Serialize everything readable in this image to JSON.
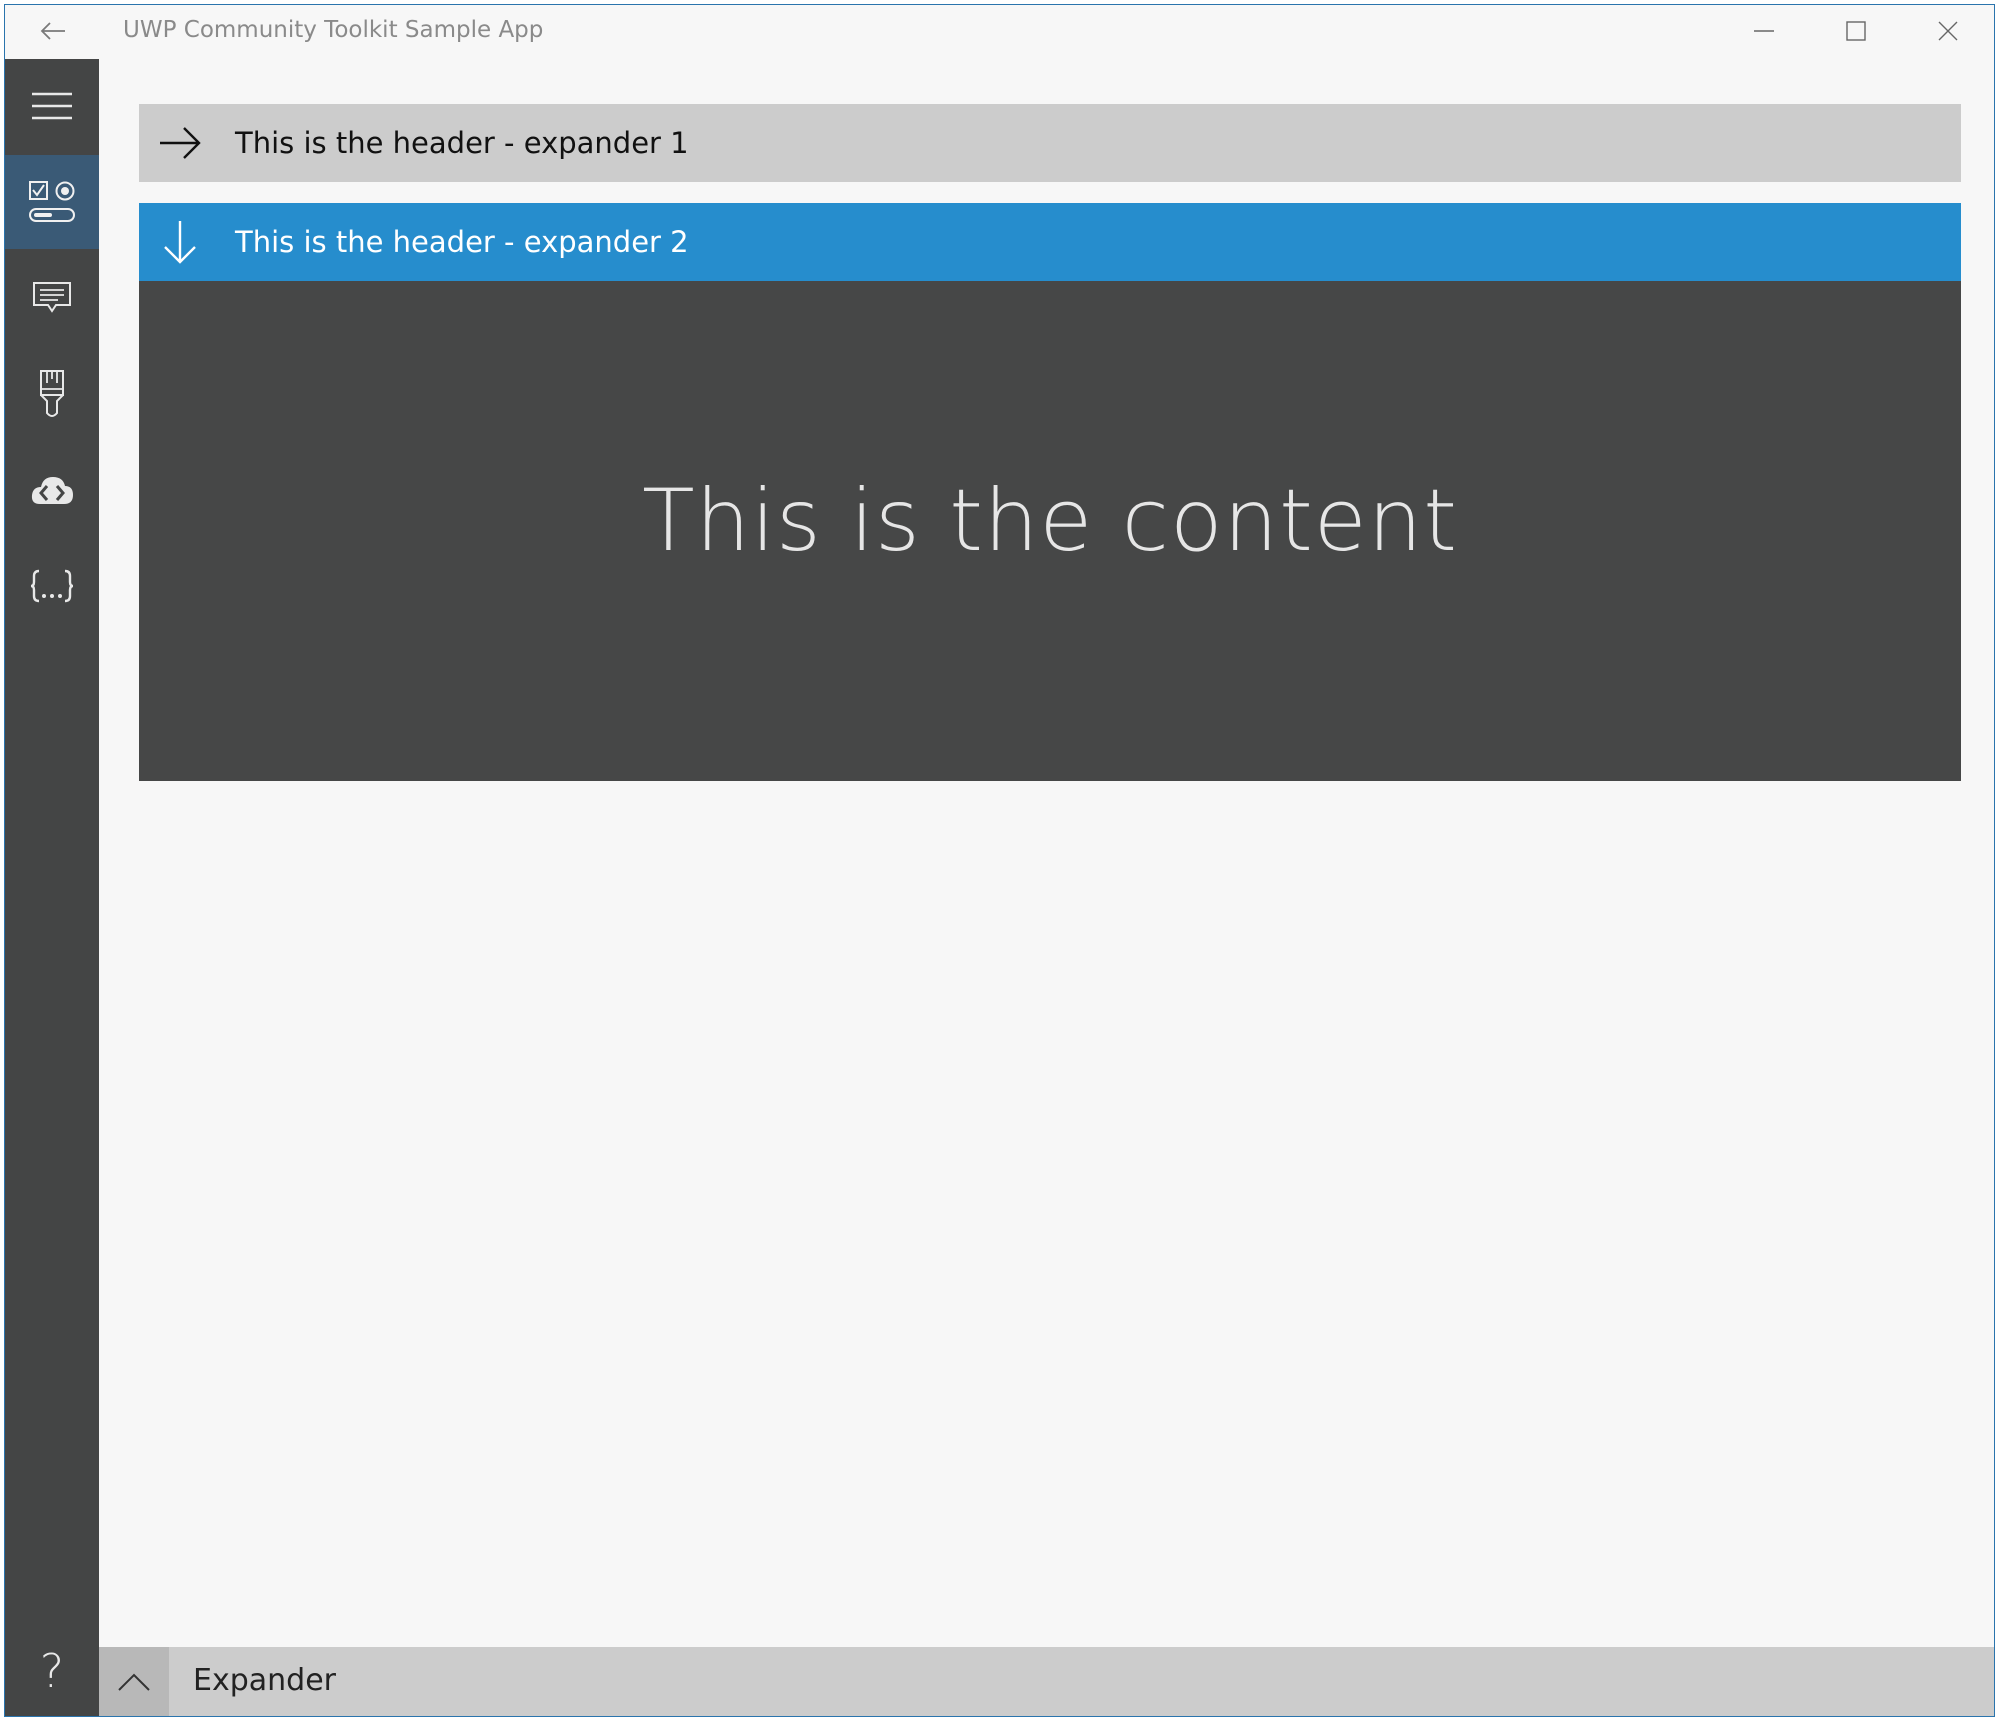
{
  "app": {
    "title": "UWP Community Toolkit Sample App"
  },
  "titlebar": {
    "back_icon": "arrow-left-icon",
    "controls": [
      "minimize-icon",
      "maximize-icon",
      "close-icon"
    ]
  },
  "nav": {
    "items": [
      {
        "icon": "hamburger-menu-icon",
        "selected": false
      },
      {
        "icon": "controls-icon",
        "selected": true
      },
      {
        "icon": "notifications-icon",
        "selected": false
      },
      {
        "icon": "brush-icon",
        "selected": false
      },
      {
        "icon": "cloud-code-icon",
        "selected": false
      },
      {
        "icon": "braces-icon",
        "selected": false
      }
    ],
    "help_label": "?"
  },
  "expanders": [
    {
      "header": "This is the header - expander 1",
      "expanded": false,
      "icon": "arrow-right-icon"
    },
    {
      "header": "This is the header - expander 2",
      "expanded": true,
      "icon": "arrow-down-icon",
      "content": "This is the content"
    }
  ],
  "bottombar": {
    "toggle_icon": "chevron-up-icon",
    "title": "Expander"
  },
  "colors": {
    "accent": "#268dcd",
    "nav_background": "#444545",
    "nav_selected": "#3a5a76",
    "collapsed_header": "#cccccc",
    "content_background": "#464747"
  }
}
